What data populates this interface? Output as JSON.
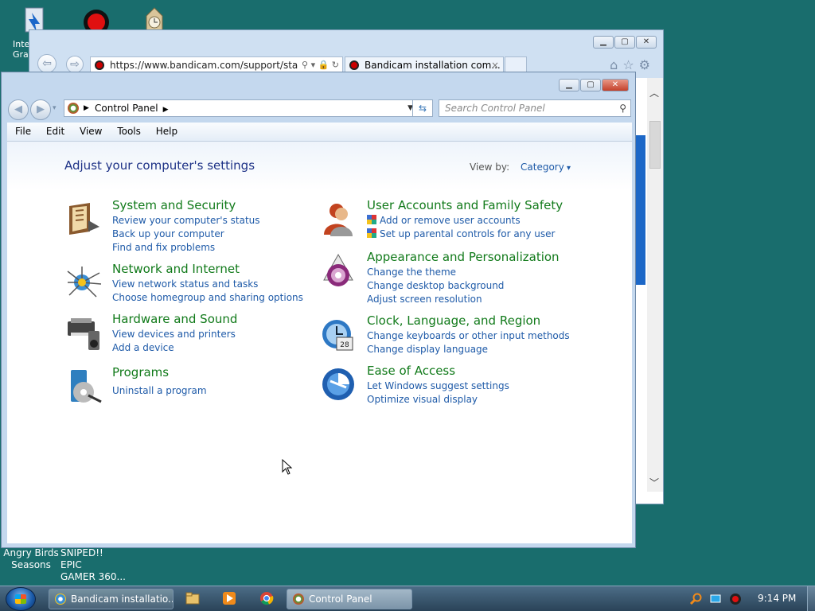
{
  "desktop": {
    "icons_top": [
      {
        "name": "intel-graphics-icon",
        "label_line1": "Inte",
        "label_line2": "Gra"
      },
      {
        "name": "bandicam-icon",
        "label_line1": "",
        "label_line2": ""
      },
      {
        "name": "clock-app-icon",
        "label_line1": "",
        "label_line2": ""
      }
    ],
    "bottom_labels": [
      {
        "line1": "Angry Birds",
        "line2": "Seasons"
      },
      {
        "line1": "SNIPED!! EPIC",
        "line2": "GAMER 360..."
      }
    ]
  },
  "ie_window": {
    "address": "https://www.bandicam.com/support/star",
    "tab_title": "Bandicam installation com...",
    "tab_close": "×",
    "icons": [
      "home-icon",
      "favorites-star-icon",
      "settings-gear-icon"
    ]
  },
  "control_panel": {
    "breadcrumb": "Control Panel",
    "search_placeholder": "Search Control Panel",
    "menu": [
      "File",
      "Edit",
      "View",
      "Tools",
      "Help"
    ],
    "title": "Adjust your computer's settings",
    "view_by_label": "View by:",
    "view_by_value": "Category",
    "categories_left": [
      {
        "heading": "System and Security",
        "icon": "system-security-icon",
        "links": [
          "Review your computer's status",
          "Back up your computer",
          "Find and fix problems"
        ]
      },
      {
        "heading": "Network and Internet",
        "icon": "network-icon",
        "links": [
          "View network status and tasks",
          "Choose homegroup and sharing options"
        ]
      },
      {
        "heading": "Hardware and Sound",
        "icon": "hardware-sound-icon",
        "links": [
          "View devices and printers",
          "Add a device"
        ]
      },
      {
        "heading": "Programs",
        "icon": "programs-icon",
        "links": [
          "Uninstall a program"
        ]
      }
    ],
    "categories_right": [
      {
        "heading": "User Accounts and Family Safety",
        "icon": "user-accounts-icon",
        "links": [
          "Add or remove user accounts",
          "Set up parental controls for any user"
        ]
      },
      {
        "heading": "Appearance and Personalization",
        "icon": "appearance-icon",
        "links": [
          "Change the theme",
          "Change desktop background",
          "Adjust screen resolution"
        ]
      },
      {
        "heading": "Clock, Language, and Region",
        "icon": "clock-language-icon",
        "links": [
          "Change keyboards or other input methods",
          "Change display language"
        ]
      },
      {
        "heading": "Ease of Access",
        "icon": "ease-of-access-icon",
        "links": [
          "Let Windows suggest settings",
          "Optimize visual display"
        ]
      }
    ]
  },
  "taskbar": {
    "items": [
      {
        "label": "Bandicam installatio...",
        "icon": "ie-icon"
      },
      {
        "label": "Control Panel",
        "icon": "control-panel-icon"
      }
    ],
    "pinned": [
      "explorer-icon",
      "media-player-icon",
      "chrome-icon"
    ],
    "tray_icons": [
      "search-tray-icon",
      "network-tray-icon",
      "bandicam-tray-icon"
    ],
    "clock": "9:14 PM"
  }
}
